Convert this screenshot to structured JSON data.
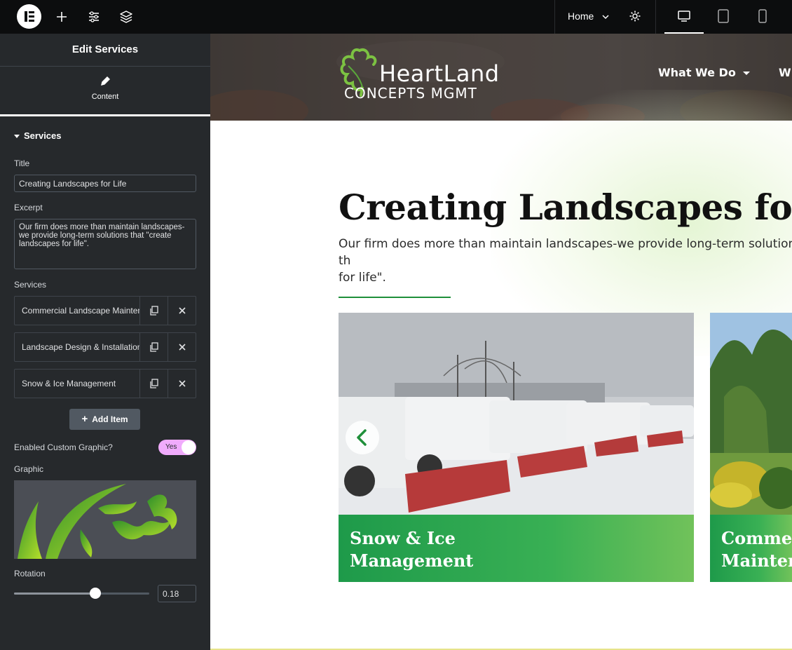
{
  "topbar": {
    "page_selector": "Home"
  },
  "panel": {
    "title": "Edit Services",
    "tab_label": "Content",
    "section": "Services",
    "title_label": "Title",
    "title_value": "Creating Landscapes for Life",
    "excerpt_label": "Excerpt",
    "excerpt_value": "Our firm does more than maintain landscapes-we provide long-term solutions that \"create landscapes for life\".",
    "services_label": "Services",
    "services": [
      {
        "title": "Commercial Landscape Maintenance"
      },
      {
        "title": "Landscape Design & Installation"
      },
      {
        "title": "Snow & Ice Management"
      }
    ],
    "add_item": "Add Item",
    "custom_graphic_label": "Enabled Custom Graphic?",
    "custom_graphic_value": "Yes",
    "graphic_label": "Graphic",
    "rotation_label": "Rotation",
    "rotation_value": "0.18",
    "rotation_fraction": 0.6
  },
  "preview": {
    "brand_line1": "HeartLand",
    "brand_line2": "CONCEPTS  MGMT",
    "nav": [
      "What We Do",
      "W"
    ],
    "heading": "Creating Landscapes for Life",
    "excerpt_line1": "Our firm does more than maintain landscapes-we provide long-term solutions th",
    "excerpt_line2": "for life\".",
    "cards": [
      {
        "line1": "Snow & Ice",
        "line2": "Management"
      },
      {
        "line1": "Commer",
        "line2": "Maintena"
      }
    ]
  },
  "colors": {
    "accent_green": "#1f8f3a",
    "toggle_pink": "#f0abfc",
    "panel_bg": "#26292c"
  }
}
